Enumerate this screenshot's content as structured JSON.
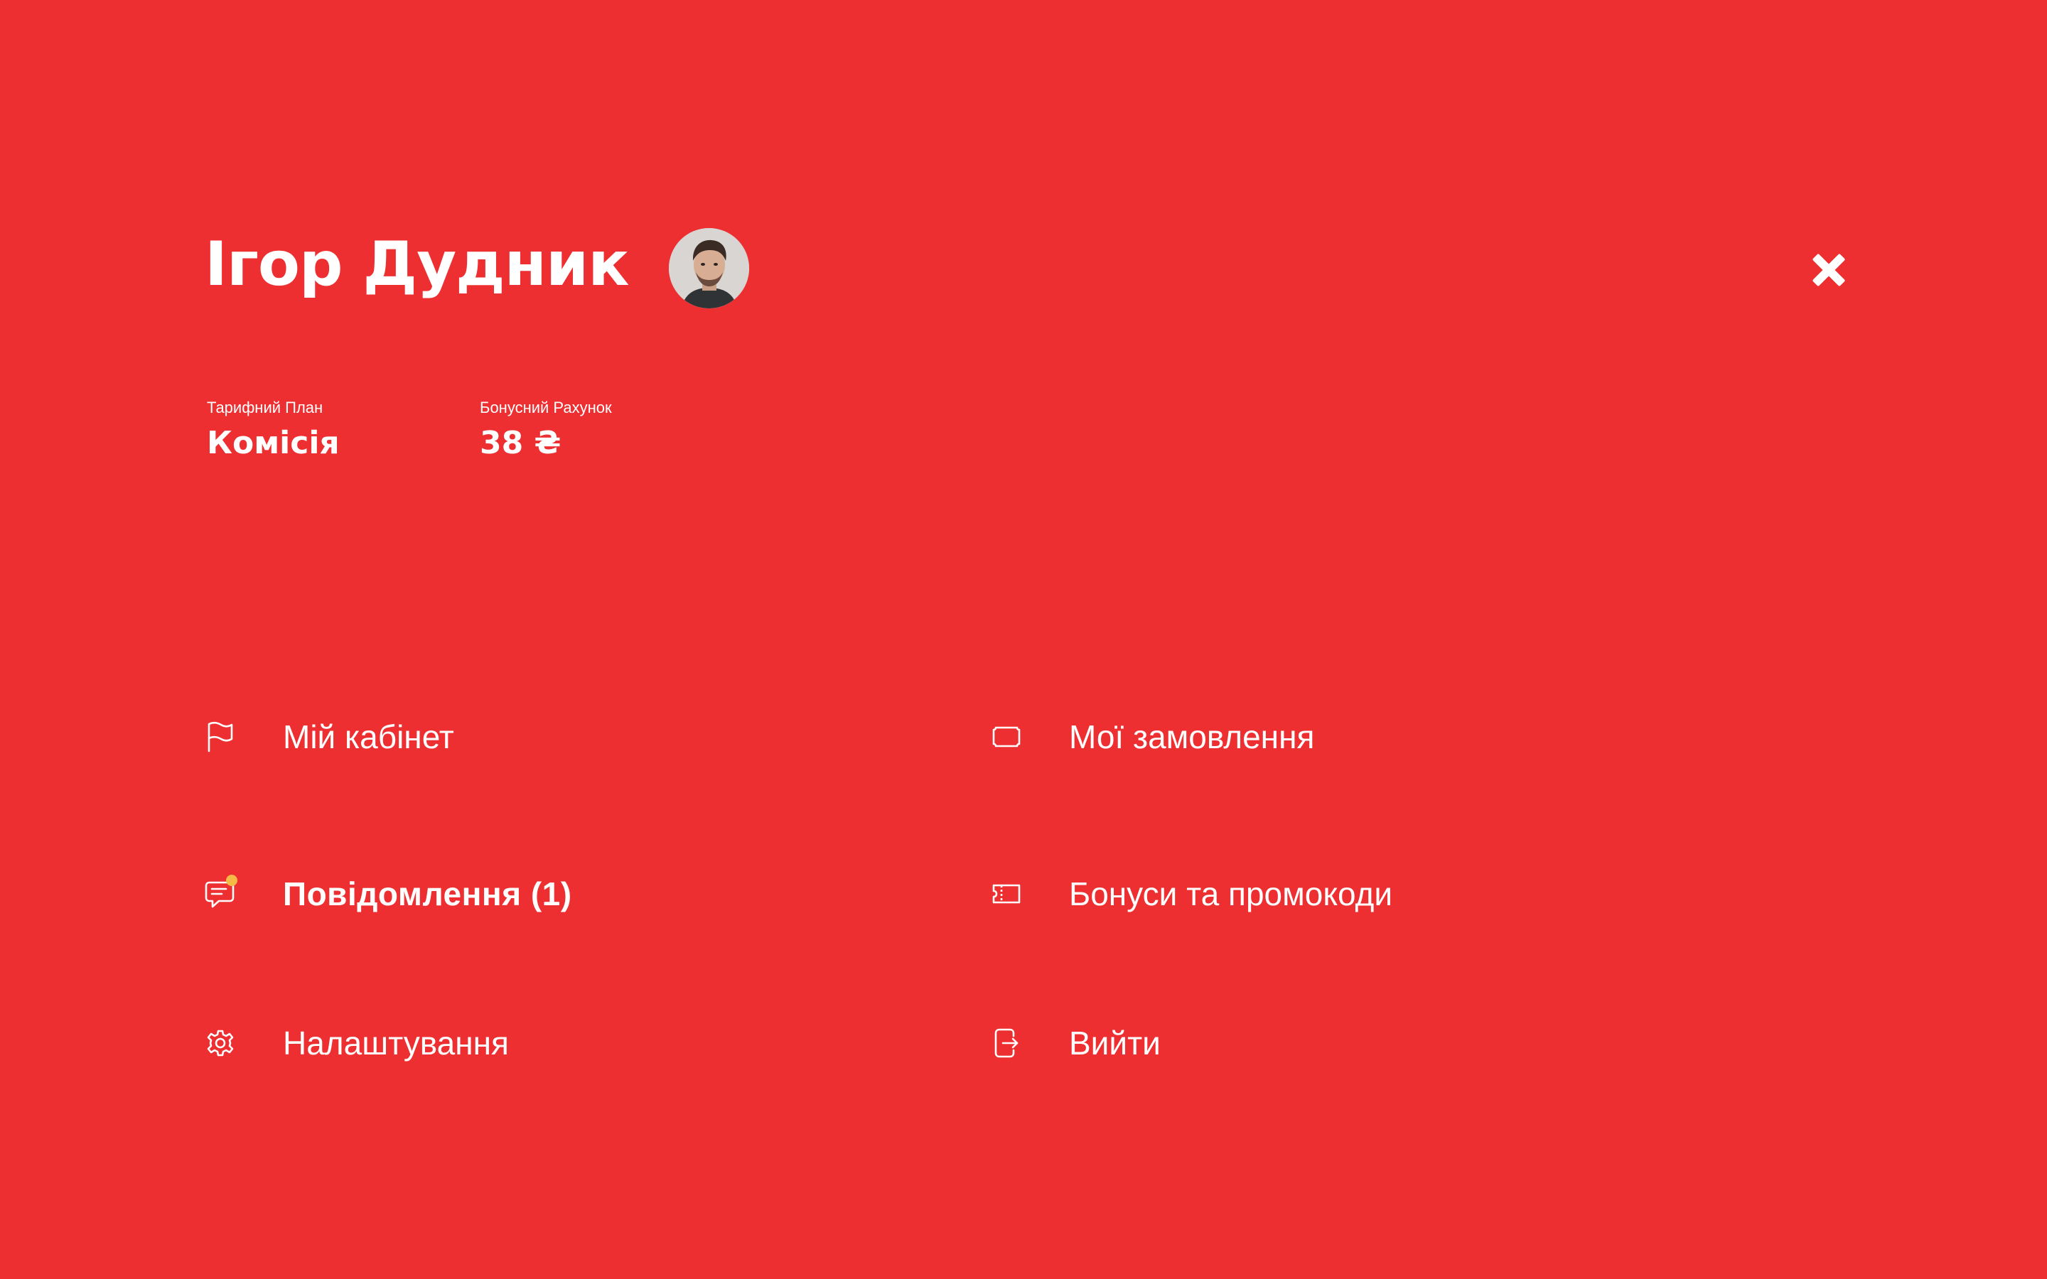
{
  "profile": {
    "name": "Ігор Дудник",
    "avatar_alt": "avatar"
  },
  "stats": {
    "plan_label": "Тарифний План",
    "plan_value": "Комісія",
    "bonus_label": "Бонусний Рахунок",
    "bonus_value": "38 ₴"
  },
  "menu": {
    "left": [
      {
        "label": "Мій кабінет",
        "icon": "flag-icon"
      },
      {
        "label": "Повідомлення  (1)",
        "icon": "chat-icon",
        "badge": true
      },
      {
        "label": "Налаштування",
        "icon": "gear-icon"
      }
    ],
    "right": [
      {
        "label": "Мої замовлення",
        "icon": "ticket-icon"
      },
      {
        "label": "Бонуси та промокоди",
        "icon": "coupon-icon"
      },
      {
        "label": "Вийти",
        "icon": "logout-icon"
      }
    ]
  },
  "colors": {
    "background": "#ED2F31",
    "text": "#FFFFFF",
    "notification_badge": "#F5B945"
  }
}
